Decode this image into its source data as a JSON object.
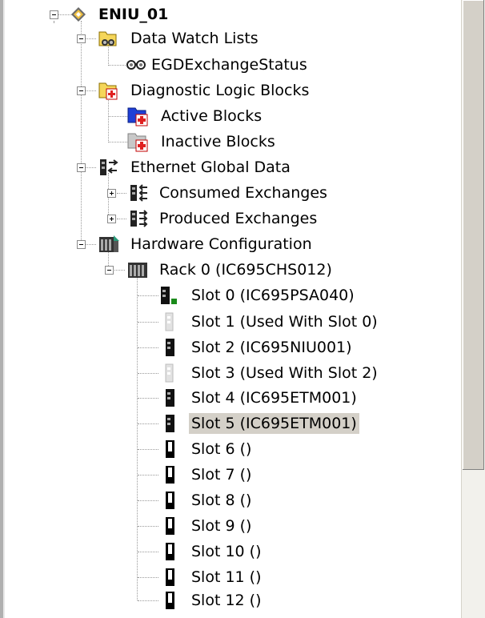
{
  "tree": {
    "root": {
      "label": "ENIU_01",
      "icon": "target-diamond-icon"
    },
    "nodes": [
      {
        "label": "Data Watch Lists",
        "icon": "watch-list-folder-icon"
      },
      {
        "label": "EGDExchangeStatus",
        "icon": "glasses-icon"
      },
      {
        "label": "Diagnostic Logic Blocks",
        "icon": "diagnostic-folder-icon"
      },
      {
        "label": "Active Blocks",
        "icon": "active-blocks-icon"
      },
      {
        "label": "Inactive Blocks",
        "icon": "inactive-blocks-icon"
      },
      {
        "label": "Ethernet Global Data",
        "icon": "ethernet-exchange-icon"
      },
      {
        "label": "Consumed Exchanges",
        "icon": "consumed-exchange-icon"
      },
      {
        "label": "Produced Exchanges",
        "icon": "produced-exchange-icon"
      },
      {
        "label": "Hardware Configuration",
        "icon": "hardware-config-icon"
      },
      {
        "label": "Rack 0 (IC695CHS012)",
        "icon": "rack-icon"
      }
    ],
    "slots": [
      {
        "label": "Slot 0 (IC695PSA040)",
        "icon": "power-supply-module-icon"
      },
      {
        "label": "Slot 1 (Used With Slot 0)",
        "icon": "used-slot-icon"
      },
      {
        "label": "Slot 2 (IC695NIU001)",
        "icon": "module-icon"
      },
      {
        "label": "Slot 3 (Used With Slot 2)",
        "icon": "used-slot-icon"
      },
      {
        "label": "Slot 4 (IC695ETM001)",
        "icon": "module-icon"
      },
      {
        "label": "Slot 5 (IC695ETM001)",
        "icon": "module-icon",
        "selected": true
      },
      {
        "label": "Slot 6 ()",
        "icon": "empty-slot-icon"
      },
      {
        "label": "Slot 7 ()",
        "icon": "empty-slot-icon"
      },
      {
        "label": "Slot 8 ()",
        "icon": "empty-slot-icon"
      },
      {
        "label": "Slot 9 ()",
        "icon": "empty-slot-icon"
      },
      {
        "label": "Slot 10 ()",
        "icon": "empty-slot-icon"
      },
      {
        "label": "Slot 11 ()",
        "icon": "empty-slot-icon"
      },
      {
        "label": "Slot 12 ()",
        "icon": "empty-slot-icon"
      }
    ],
    "colors": {
      "selected_bg": "#d4d0c8",
      "active_blue": "#1f3fd6",
      "diag_red": "#e02020",
      "psu_green": "#1a8a1a"
    }
  }
}
